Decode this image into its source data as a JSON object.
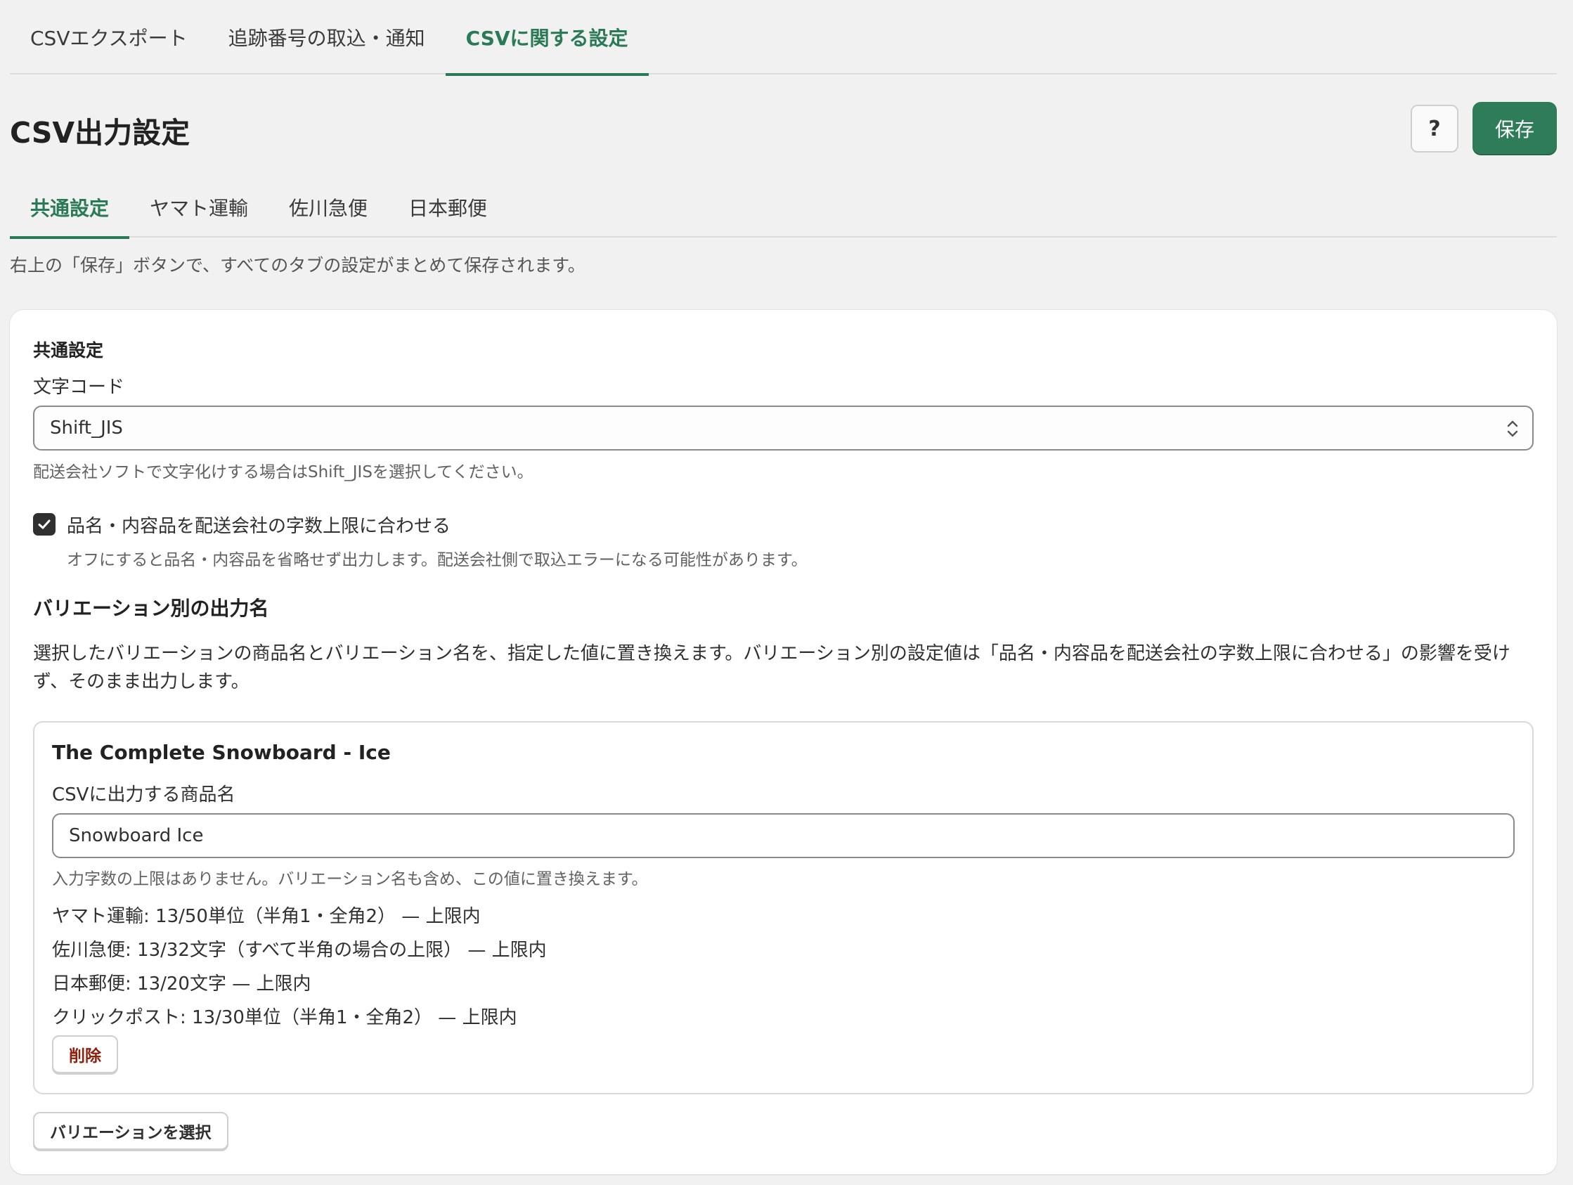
{
  "top_tabs": [
    {
      "label": "CSVエクスポート",
      "active": false
    },
    {
      "label": "追跡番号の取込・通知",
      "active": false
    },
    {
      "label": "CSVに関する設定",
      "active": true
    }
  ],
  "header": {
    "title": "CSV出力設定",
    "help_label": "?",
    "save_label": "保存"
  },
  "sub_tabs": [
    {
      "label": "共通設定",
      "active": true
    },
    {
      "label": "ヤマト運輸",
      "active": false
    },
    {
      "label": "佐川急便",
      "active": false
    },
    {
      "label": "日本郵便",
      "active": false
    }
  ],
  "note": "右上の「保存」ボタンで、すべてのタブの設定がまとめて保存されます。",
  "card": {
    "title": "共通設定",
    "encoding": {
      "label": "文字コード",
      "value": "Shift_JIS",
      "help": "配送会社ソフトで文字化けする場合はShift_JISを選択してください。"
    },
    "truncate": {
      "checked": true,
      "label": "品名・内容品を配送会社の字数上限に合わせる",
      "help": "オフにすると品名・内容品を省略せず出力します。配送会社側で取込エラーになる可能性があります。"
    },
    "variation_section": {
      "heading": "バリエーション別の出力名",
      "description": "選択したバリエーションの商品名とバリエーション名を、指定した値に置き換えます。バリエーション別の設定値は「品名・内容品を配送会社の字数上限に合わせる」の影響を受けず、そのまま出力します。",
      "item": {
        "title": "The Complete Snowboard - Ice",
        "field_label": "CSVに出力する商品名",
        "field_value": "Snowboard Ice",
        "field_help": "入力字数の上限はありません。バリエーション名も含め、この値に置き換えます。",
        "limits": [
          "ヤマト運輸: 13/50単位（半角1・全角2） — 上限内",
          "佐川急便: 13/32文字（すべて半角の場合の上限） — 上限内",
          "日本郵便: 13/20文字 — 上限内",
          "クリックポスト: 13/30単位（半角1・全角2） — 上限内"
        ],
        "delete_label": "削除"
      },
      "select_button_label": "バリエーションを選択"
    }
  },
  "colors": {
    "accent": "#2a7a55",
    "primary_button": "#2f7d58",
    "danger_text": "#8e1f0b",
    "background": "#f1f1f1"
  }
}
